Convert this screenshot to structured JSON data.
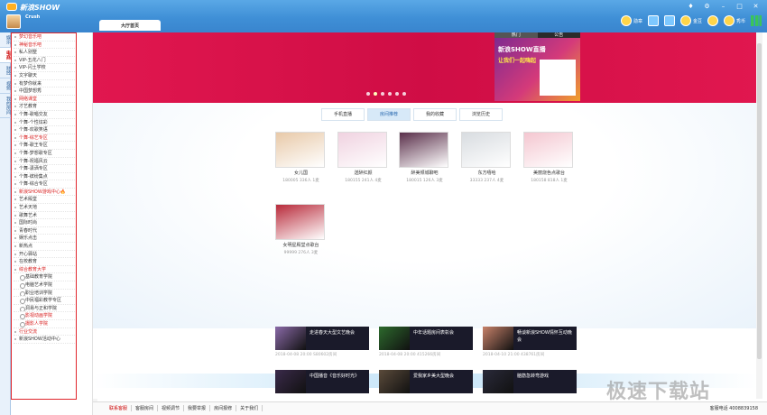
{
  "app": {
    "title": "新浪SHOW",
    "username": "Crush"
  },
  "toolbar": {
    "items": [
      {
        "label": "勋章",
        "icon": "medal-icon"
      },
      {
        "label": "",
        "icon": "search-icon"
      },
      {
        "label": "",
        "icon": "gift-icon"
      },
      {
        "label": "金豆",
        "icon": "coin-icon"
      },
      {
        "label": "",
        "icon": "bell-icon"
      },
      {
        "label": "秀币",
        "icon": "diamond-icon"
      },
      {
        "label": "",
        "icon": "chart-icon"
      }
    ]
  },
  "main_tab": "大厅首页",
  "vertical_tabs": [
    {
      "label": "娱乐",
      "active": false
    },
    {
      "label": "电商",
      "active": true
    },
    {
      "label": "财经",
      "active": false
    },
    {
      "label": "视频",
      "active": false
    },
    {
      "label": "我的房间",
      "active": false
    }
  ],
  "sidebar": {
    "items": [
      {
        "label": "梦幻音乐吧",
        "style": "red"
      },
      {
        "label": "神秘音乐吧",
        "style": "red"
      },
      {
        "label": "私人别墅",
        "style": ""
      },
      {
        "label": "VIP-五花八门",
        "style": ""
      },
      {
        "label": "VIP-闪土学校",
        "style": ""
      },
      {
        "label": "文字聊天",
        "style": ""
      },
      {
        "label": "有梦你就来",
        "style": ""
      },
      {
        "label": "中国梦想秀",
        "style": ""
      },
      {
        "label": "网络课堂",
        "style": "red"
      },
      {
        "label": "才艺教育",
        "style": ""
      },
      {
        "label": "个舞-歌唱交友",
        "style": ""
      },
      {
        "label": "个舞-个性炫彩",
        "style": ""
      },
      {
        "label": "个舞-欢歌笑语",
        "style": ""
      },
      {
        "label": "个舞-综艺专区",
        "style": "red"
      },
      {
        "label": "个舞-歌王专区",
        "style": ""
      },
      {
        "label": "个舞-梦想歌专区",
        "style": ""
      },
      {
        "label": "个舞-祝福风云",
        "style": ""
      },
      {
        "label": "个舞-潇洒专区",
        "style": ""
      },
      {
        "label": "个舞-缤纷集点",
        "style": ""
      },
      {
        "label": "个舞-综合专区",
        "style": ""
      },
      {
        "label": "新浪SHOW游戏中心",
        "style": "red",
        "fire": "🔥"
      },
      {
        "label": "艺术殿堂",
        "style": ""
      },
      {
        "label": "艺术天地",
        "style": ""
      },
      {
        "label": "歌舞艺术",
        "style": ""
      },
      {
        "label": "国际时尚",
        "style": ""
      },
      {
        "label": "青春时代",
        "style": ""
      },
      {
        "label": "娱乐点击",
        "style": ""
      },
      {
        "label": "新热点",
        "style": ""
      },
      {
        "label": "开心驿站",
        "style": ""
      },
      {
        "label": "在校教育",
        "style": ""
      },
      {
        "label": "综合教育大学",
        "style": "red"
      },
      {
        "label": "基础教育学院",
        "style": "sub"
      },
      {
        "label": "电脑艺术学院",
        "style": "sub"
      },
      {
        "label": "职业培训学院",
        "style": "sub"
      },
      {
        "label": "中民福彩教学专区",
        "style": "sub"
      },
      {
        "label": "洞易与正和学院",
        "style": "sub"
      },
      {
        "label": "影视动画学院",
        "style": "sub red"
      },
      {
        "label": "摄影人学院",
        "style": "sub red"
      },
      {
        "label": "行业交流",
        "style": "red"
      },
      {
        "label": "新浪SHOW活动中心",
        "style": ""
      }
    ]
  },
  "banner": {
    "hot_tabs": [
      "热门",
      "公告"
    ],
    "ad_title": "新浪SHOW直播",
    "ad_sub": "让我们一起嗨起",
    "slides": 6,
    "active_slide": 1
  },
  "content_tabs": [
    {
      "label": "手机直播",
      "active": false
    },
    {
      "label": "房间推荐",
      "active": true
    },
    {
      "label": "我的收藏",
      "active": false
    },
    {
      "label": "浏览历史",
      "active": false
    }
  ],
  "rooms": [
    {
      "name": "女儿国",
      "meta": "180005 336人 1麦",
      "color": "#e8c9a8"
    },
    {
      "name": "送醉红颜",
      "meta": "180155 241人 4麦",
      "color": "#f0d2e0"
    },
    {
      "name": "醉美倾城聊吧",
      "meta": "180015 126人 3麦",
      "color": "#5a2f4a"
    },
    {
      "name": "东方嘻哈",
      "meta": "33333 237人 4麦",
      "color": "#d8dce0"
    },
    {
      "name": "美丽烧色点歌台",
      "meta": "180158 818人 1麦",
      "color": "#f4c6d0"
    },
    {
      "name": "女明星殿堂点歌台",
      "meta": "99999 276人 3麦",
      "color": "#b82a3a"
    }
  ],
  "activity": {
    "title": "房间活动",
    "items": [
      {
        "title": "走进春天大型文艺晚会",
        "date": "2018-04-08 20:00 S80602房间",
        "color": "#8a6aa8"
      },
      {
        "title": "中年话题房间表彰会",
        "date": "2018-04-08 20:00 415266房间",
        "color": "#2d6a2d"
      },
      {
        "title": "畅谈新浪SHOW情怀互动晚会",
        "date": "2018-04-10 21:00 438761房间",
        "color": "#c8826a"
      },
      {
        "title": "中国播音《音乐好时光》",
        "date": "",
        "color": "#3a2a4a"
      },
      {
        "title": "爱我家乡美大型晚会",
        "date": "",
        "color": "#5a4a3a"
      },
      {
        "title": "脑筋急转弯游戏",
        "date": "",
        "color": "#2a2a3a"
      }
    ]
  },
  "footer": {
    "links": [
      {
        "label": "联系客服",
        "style": "red"
      },
      {
        "label": "客服房间",
        "style": ""
      },
      {
        "label": "视频调节",
        "style": ""
      },
      {
        "label": "我要举报",
        "style": ""
      },
      {
        "label": "房间报修",
        "style": ""
      },
      {
        "label": "关于我们",
        "style": ""
      }
    ],
    "phone": "客服电话 4008839158"
  },
  "watermark": "极速下载站"
}
